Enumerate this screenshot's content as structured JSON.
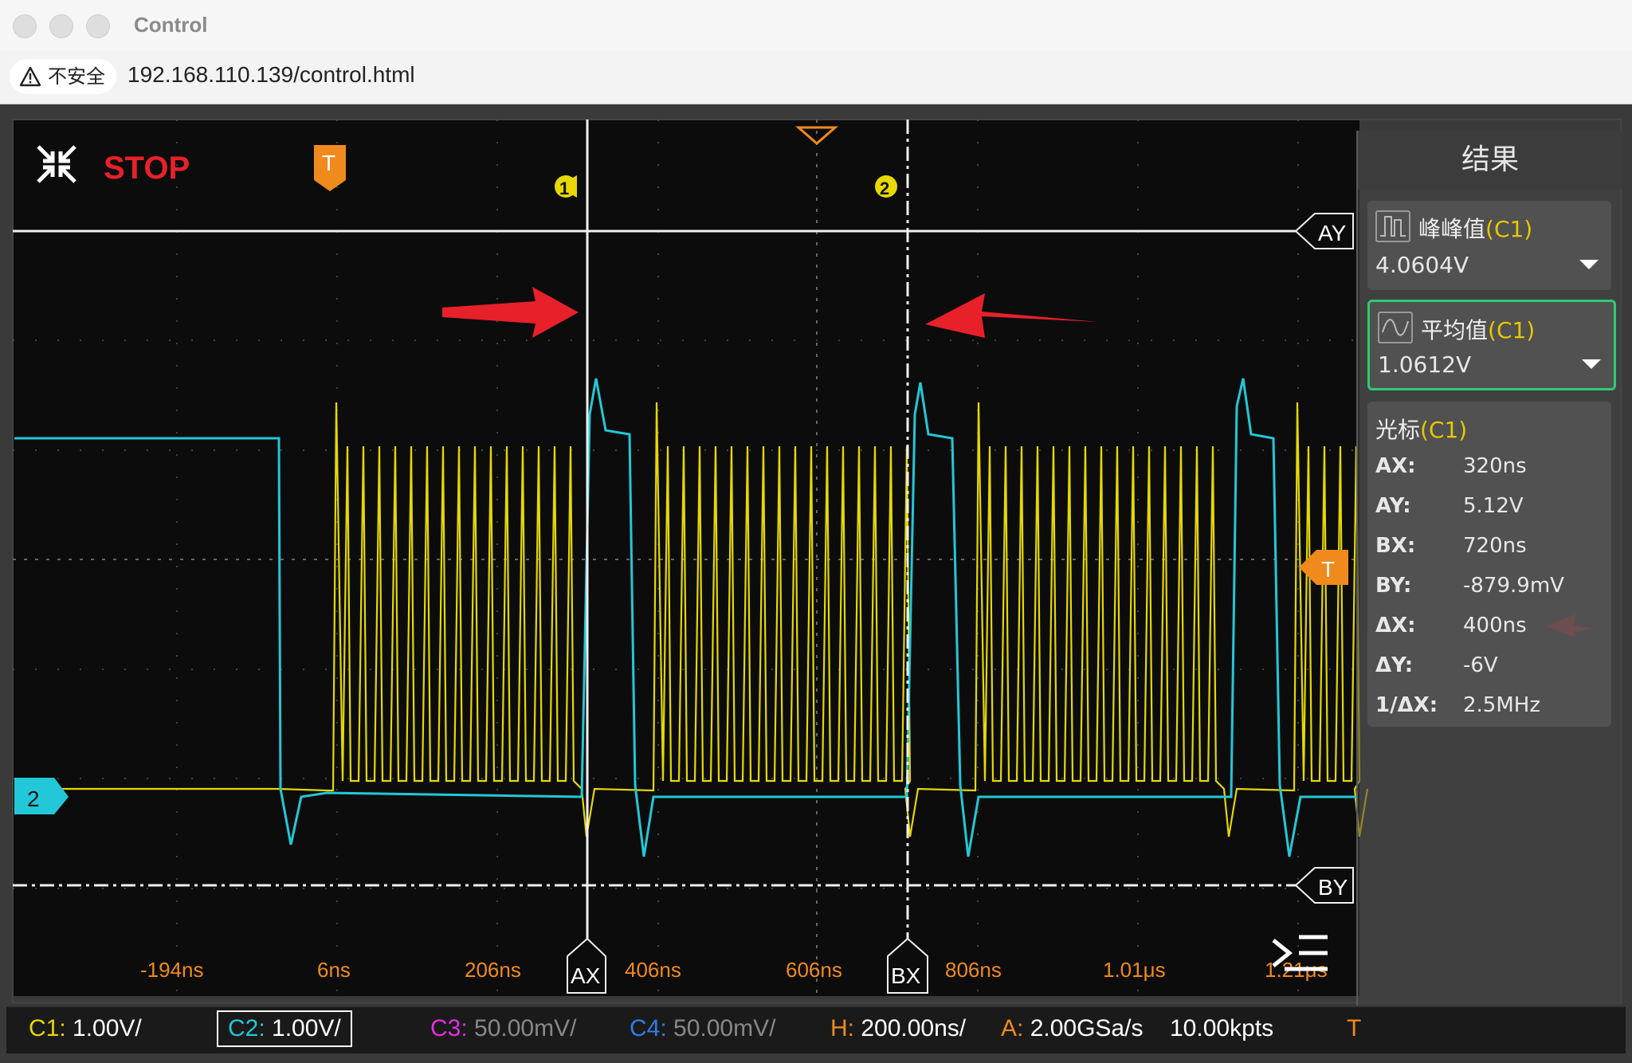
{
  "window": {
    "title": "Control"
  },
  "address_bar": {
    "security_label": "不安全",
    "url": "192.168.110.139/control.html"
  },
  "scope": {
    "run_state": "STOP",
    "trigger_marker": "T",
    "cursor_1_label": "1",
    "cursor_2_label": "2",
    "cursor_ay_tag": "AY",
    "cursor_by_tag": "BY",
    "cursor_ax_tag": "AX",
    "cursor_bx_tag": "BX",
    "channel_2_marker": "2",
    "trigger_level_marker": "T",
    "time_ticks": [
      "-194ns",
      "6ns",
      "206ns",
      "406ns",
      "606ns",
      "806ns",
      "1.01μs",
      "1.21μs"
    ],
    "colors": {
      "ch1": "#e6d800",
      "ch2": "#22c8d8",
      "ch3": "#e030e0",
      "ch4": "#2f7de8",
      "accent_red": "#e8202a",
      "trigger_orange": "#f08a1c"
    }
  },
  "results_panel": {
    "title": "结果",
    "measurements": [
      {
        "name": "峰峰值",
        "channel": "(C1)",
        "value": "4.0604V",
        "selected": false
      },
      {
        "name": "平均值",
        "channel": "(C1)",
        "value": "1.0612V",
        "selected": true
      }
    ],
    "cursor_section": {
      "title": "光标",
      "channel": "(C1)",
      "rows": [
        {
          "key": "AX:",
          "value": "320ns"
        },
        {
          "key": "AY:",
          "value": "5.12V"
        },
        {
          "key": "BX:",
          "value": "720ns"
        },
        {
          "key": "BY:",
          "value": "-879.9mV"
        },
        {
          "key": "ΔX:",
          "value": "400ns"
        },
        {
          "key": "ΔY:",
          "value": "-6V"
        },
        {
          "key": "1/ΔX:",
          "value": "2.5MHz"
        }
      ]
    }
  },
  "status_bar": {
    "c1": {
      "label": "C1:",
      "value": "1.00V/"
    },
    "c2": {
      "label": "C2:",
      "value": "1.00V/"
    },
    "c3": {
      "label": "C3:",
      "value": "50.00mV/"
    },
    "c4": {
      "label": "C4:",
      "value": "50.00mV/"
    },
    "h": {
      "label": "H:",
      "value": "200.00ns/"
    },
    "a": {
      "label": "A:",
      "value": "2.00GSa/s"
    },
    "kpts": "10.00kpts",
    "trigger_tail": "T"
  }
}
